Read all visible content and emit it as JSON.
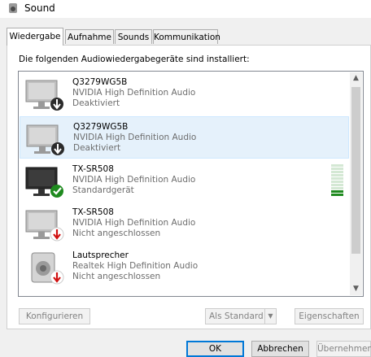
{
  "window": {
    "title": "Sound"
  },
  "tabs": [
    {
      "label": "Wiedergabe",
      "active": true
    },
    {
      "label": "Aufnahme"
    },
    {
      "label": "Sounds"
    },
    {
      "label": "Kommunikation"
    }
  ],
  "heading": "Die folgenden Audiowiedergabegeräte sind installiert:",
  "devices": [
    {
      "name": "Q3279WG5B",
      "driver": "NVIDIA High Definition Audio",
      "status": "Deaktiviert",
      "icon": "monitor-disabled-icon"
    },
    {
      "name": "Q3279WG5B",
      "driver": "NVIDIA High Definition Audio",
      "status": "Deaktiviert",
      "icon": "monitor-disabled-icon",
      "selected": true
    },
    {
      "name": "TX-SR508",
      "driver": "NVIDIA High Definition Audio",
      "status": "Standardgerät",
      "icon": "monitor-default-icon",
      "level": 0.2
    },
    {
      "name": "TX-SR508",
      "driver": "NVIDIA High Definition Audio",
      "status": "Nicht angeschlossen",
      "icon": "monitor-unplugged-icon"
    },
    {
      "name": "Lautsprecher",
      "driver": "Realtek High Definition Audio",
      "status": "Nicht angeschlossen",
      "icon": "speaker-unplugged-icon"
    }
  ],
  "buttons": {
    "configure": "Konfigurieren",
    "set_default": "Als Standard",
    "properties": "Eigenschaften",
    "ok": "OK",
    "cancel": "Abbrechen",
    "apply": "Übernehmen"
  },
  "colors": {
    "accent": "#0078d7",
    "ok_green": "#1f8a1f",
    "warn_red": "#d01010"
  }
}
